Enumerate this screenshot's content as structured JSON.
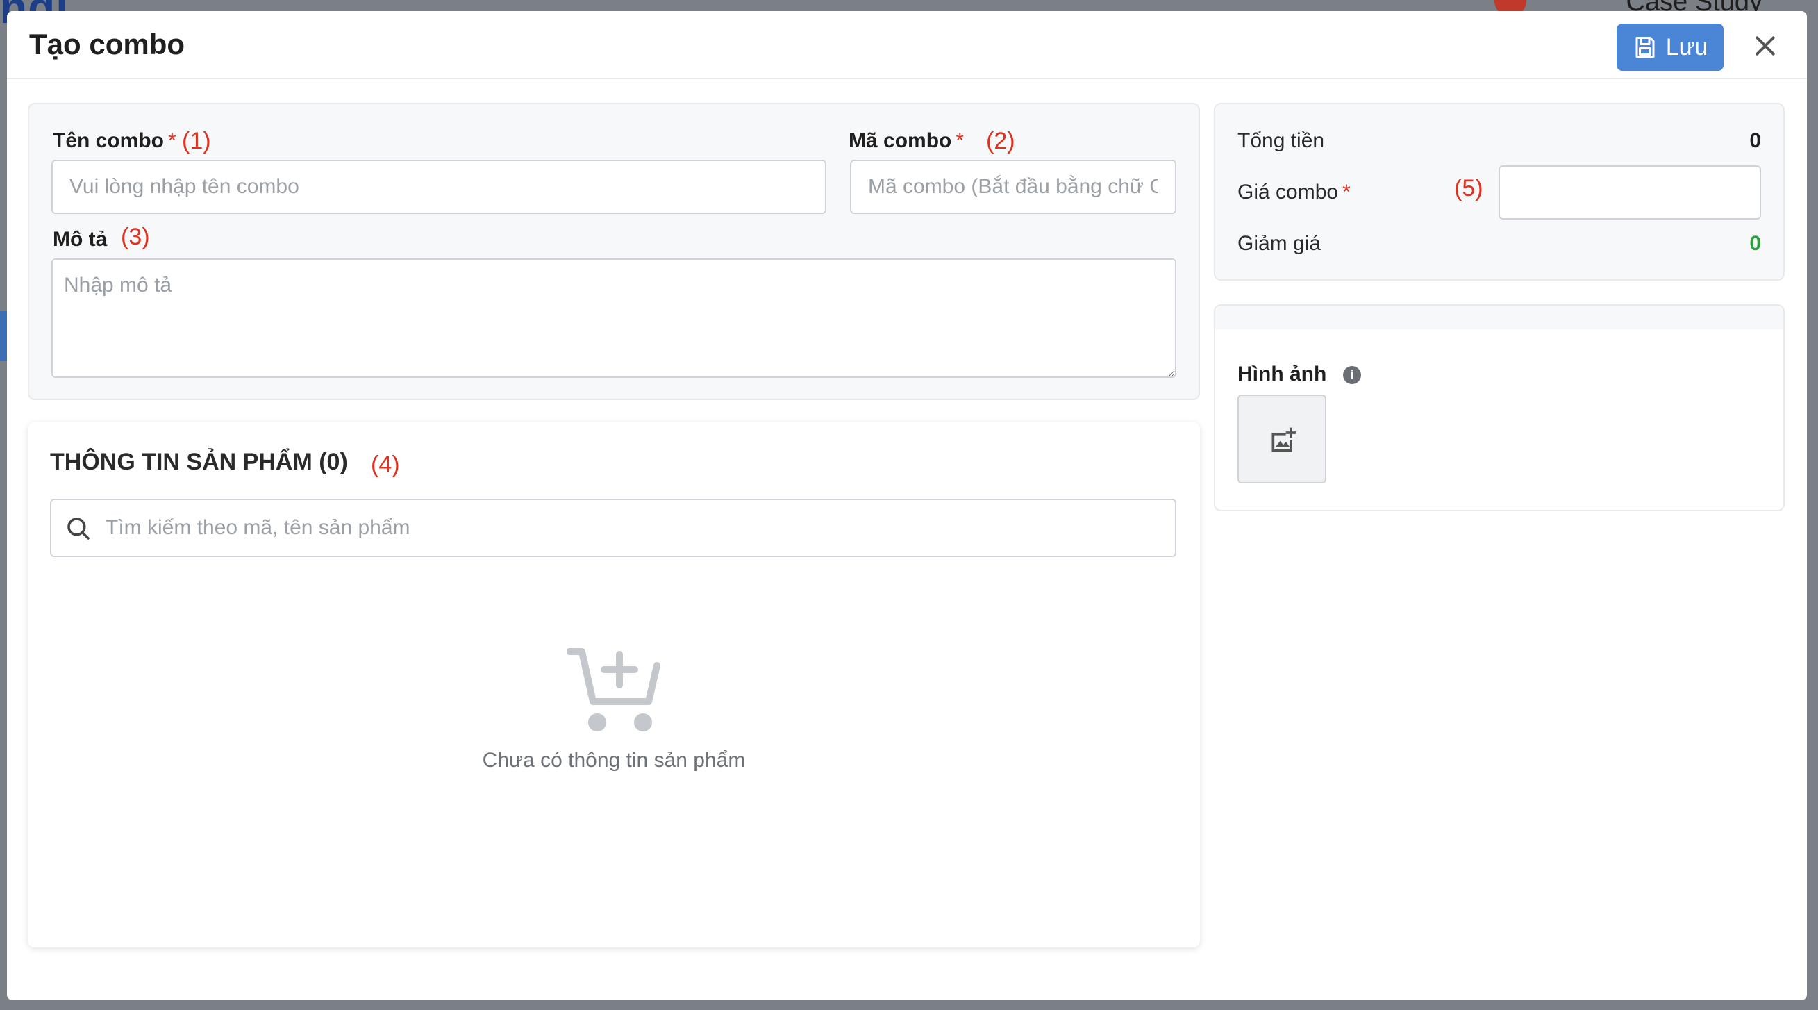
{
  "background": {
    "logo_fragment": "ndi",
    "account_fragment": "Case Study"
  },
  "modal": {
    "title": "Tạo combo",
    "save_label": "Lưu",
    "close_icon": "close-icon",
    "save_icon": "save-icon"
  },
  "form": {
    "name": {
      "label": "Tên combo",
      "required": "*",
      "annotation": "(1)",
      "placeholder": "Vui lòng nhập tên combo",
      "value": ""
    },
    "code": {
      "label": "Mã combo",
      "required": "*",
      "annotation": "(2)",
      "placeholder": "Mã combo (Bắt đầu bằng chữ C)",
      "value": ""
    },
    "description": {
      "label": "Mô tả",
      "annotation": "(3)",
      "placeholder": "Nhập mô tả",
      "value": ""
    }
  },
  "products": {
    "title": "THÔNG TIN SẢN PHẨM (0)",
    "annotation": "(4)",
    "search_placeholder": "Tìm kiếm theo mã, tên sản phẩm",
    "empty_text": "Chưa có thông tin sản phẩm",
    "empty_icon": "cart-add-icon"
  },
  "summary": {
    "total_label": "Tổng tiền",
    "total_value": "0",
    "price_label": "Giá combo",
    "price_required": "*",
    "price_annotation": "(5)",
    "price_value": "",
    "discount_label": "Giảm giá",
    "discount_value": "0",
    "discount_color": "#2e9e3e"
  },
  "image": {
    "label": "Hình ảnh",
    "info_glyph": "i",
    "upload_icon": "image-add-icon"
  },
  "colors": {
    "primary": "#4a85d6",
    "required": "#e0301e"
  }
}
